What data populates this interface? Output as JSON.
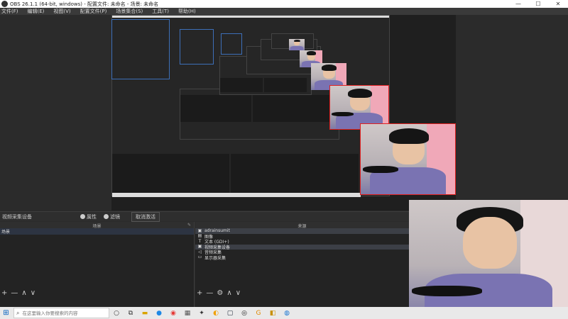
{
  "window": {
    "title": "OBS 26.1.1 (64-bit, windows) - 配置文件: 未命名 - 场景: 未命名",
    "minimize": "—",
    "maximize": "☐",
    "close": "✕"
  },
  "menu": {
    "items": [
      "文件(F)",
      "编辑(E)",
      "视图(V)",
      "配置文件(P)",
      "场景集合(S)",
      "工具(T)",
      "帮助(H)"
    ]
  },
  "source_toolbar": {
    "current_source": "视频采集设备",
    "properties_label": "属性",
    "filters_label": "滤镜",
    "deactivate_label": "取消激活"
  },
  "scenes_panel": {
    "header": "场景",
    "items": [
      "场景"
    ]
  },
  "sources_panel": {
    "header": "来源",
    "items": [
      {
        "icon": "▣",
        "label": "adrainsumit"
      },
      {
        "icon": "▤",
        "label": "图像"
      },
      {
        "icon": "T",
        "label": "文本 (GDI+)"
      },
      {
        "icon": "▣",
        "label": "视频采集设备"
      },
      {
        "icon": "◁",
        "label": "音频采集"
      },
      {
        "icon": "▭",
        "label": "显示器采集"
      }
    ]
  },
  "panel_tools": {
    "scenes": [
      "+",
      "—",
      "∧",
      "∨"
    ],
    "sources": [
      "+",
      "—",
      "⚙",
      "∧",
      "∨"
    ]
  },
  "taskbar": {
    "start": "⊞",
    "search_icon": "⌕",
    "search_placeholder": "在这里输入你要搜索的内容",
    "apps": [
      "○",
      "⧉",
      "▬",
      "●",
      "◉",
      "▦",
      "✦",
      "◐",
      "▢",
      "◎",
      "G",
      "◧",
      "◍"
    ]
  },
  "colors": {
    "selection_border": "#e02020",
    "scene_preview_outline": "#3d6fb8",
    "accent": "#0060c0"
  }
}
